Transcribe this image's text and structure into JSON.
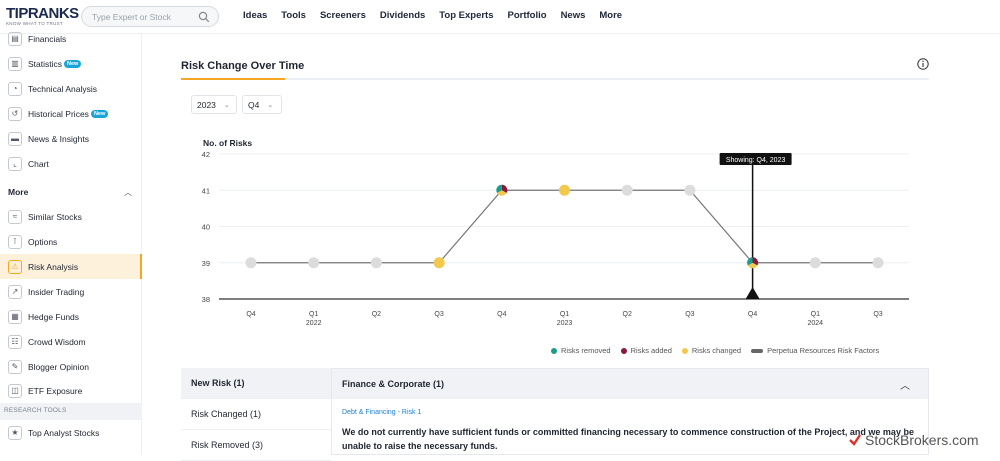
{
  "logo": {
    "text": "TIPRANKS",
    "tagline": "KNOW WHAT TO TRUST"
  },
  "search": {
    "placeholder": "Type Expert or Stock"
  },
  "nav": [
    "Ideas",
    "Tools",
    "Screeners",
    "Dividends",
    "Top Experts",
    "Portfolio",
    "News",
    "More"
  ],
  "sidebar": {
    "items": [
      {
        "label": "Financials",
        "icon": "financials-icon"
      },
      {
        "label": "Statistics",
        "icon": "statistics-icon",
        "badge": "New"
      },
      {
        "label": "Technical Analysis",
        "icon": "technical-icon"
      },
      {
        "label": "Historical Prices",
        "icon": "historical-icon",
        "badge": "New"
      },
      {
        "label": "News & Insights",
        "icon": "news-icon"
      },
      {
        "label": "Chart",
        "icon": "chart-icon"
      }
    ],
    "more_label": "More",
    "more_items": [
      {
        "label": "Similar Stocks",
        "icon": "similar-icon"
      },
      {
        "label": "Options",
        "icon": "options-icon"
      },
      {
        "label": "Risk Analysis",
        "icon": "warning-icon",
        "active": true
      },
      {
        "label": "Insider Trading",
        "icon": "insider-icon"
      },
      {
        "label": "Hedge Funds",
        "icon": "hedge-icon"
      },
      {
        "label": "Crowd Wisdom",
        "icon": "crowd-icon"
      },
      {
        "label": "Blogger Opinion",
        "icon": "blogger-icon"
      },
      {
        "label": "ETF Exposure",
        "icon": "etf-icon"
      }
    ],
    "section_label": "RESEARCH TOOLS",
    "tools": [
      {
        "label": "Top Analyst Stocks",
        "icon": "analyst-icon"
      }
    ]
  },
  "main": {
    "title": "Risk Change Over Time",
    "year": "2023",
    "quarter": "Q4",
    "tooltip": "Showing: Q4, 2023"
  },
  "chart_data": {
    "type": "line",
    "ylabel": "No. of Risks",
    "ylim": [
      38,
      42
    ],
    "yticks": [
      38,
      39,
      40,
      41,
      42
    ],
    "x": [
      "Q4",
      "Q1",
      "Q2",
      "Q3",
      "Q4",
      "Q1",
      "Q2",
      "Q3",
      "Q4",
      "Q1",
      "Q3"
    ],
    "x_years": [
      "",
      "2022",
      "",
      "",
      "",
      "2023",
      "",
      "",
      "",
      "2024",
      ""
    ],
    "values": [
      39,
      39,
      39,
      39,
      41,
      41,
      41,
      41,
      39,
      39,
      39
    ],
    "point_status": [
      "none",
      "none",
      "none",
      "changed",
      "mixed",
      "changed",
      "none",
      "none",
      "mixed",
      "none",
      "none"
    ],
    "selected_index": 8,
    "grid": true,
    "legend": [
      {
        "label": "Risks removed",
        "color": "#1a9c8c"
      },
      {
        "label": "Risks added",
        "color": "#8b1a3a"
      },
      {
        "label": "Risks changed",
        "color": "#f2c94c"
      },
      {
        "label": "Perpetua Resources Risk Factors",
        "color": "#666666"
      }
    ]
  },
  "tabs": [
    {
      "label": "New Risk (1)",
      "active": true
    },
    {
      "label": "Risk Changed (1)"
    },
    {
      "label": "Risk Removed (3)"
    }
  ],
  "accordion": {
    "title": "Finance & Corporate (1)",
    "link": "Debt & Financing - Risk 1",
    "text": "We do not currently have sufficient funds or committed financing necessary to commence construction of the Project, and we may be unable to raise the necessary funds."
  },
  "watermark": "StockBrokers.com"
}
